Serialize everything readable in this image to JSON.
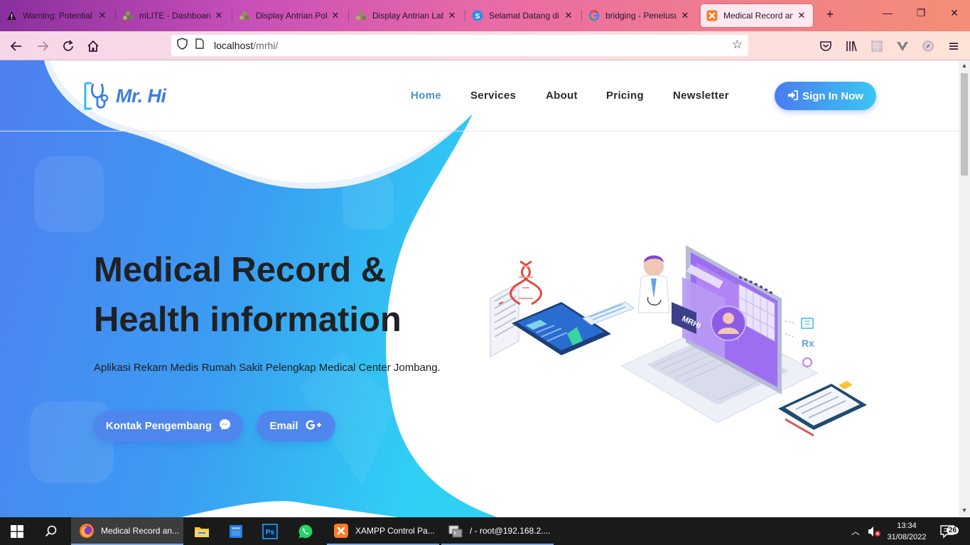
{
  "browser": {
    "tabs": [
      {
        "title": "Warning: Potential S",
        "icon": "warning-icon"
      },
      {
        "title": "mLITE - Dashboard",
        "icon": "mlite-icon"
      },
      {
        "title": "Display Antrian Poli",
        "icon": "mlite-icon"
      },
      {
        "title": "Display Antrian Lab",
        "icon": "mlite-icon"
      },
      {
        "title": "Selamat Datang di S",
        "icon": "skype-icon"
      },
      {
        "title": "bridging - Penelusur",
        "icon": "google-icon"
      },
      {
        "title": "Medical Record and",
        "icon": "xampp-icon",
        "active": true
      }
    ],
    "new_tab": "+",
    "url_host": "localhost",
    "url_path": "/mrhi/"
  },
  "site": {
    "logo_text": "Mr. Hi",
    "nav": [
      "Home",
      "Services",
      "About",
      "Pricing",
      "Newsletter"
    ],
    "active_nav": "Home",
    "signin_label": "Sign In Now",
    "hero": {
      "title_line1": "Medical Record &",
      "title_line2": "Health information",
      "description": "Aplikasi Rekam Medis Rumah Sakit Pelengkap Medical Center Jombang.",
      "cta_contact": "Kontak Pengembang",
      "cta_email": "Email"
    },
    "illustration_label": "MRHI",
    "colors": {
      "accent": "#4f86ee",
      "gradient_start": "#4a7cf0",
      "gradient_end": "#3bc6f3",
      "text_dark": "#202124"
    }
  },
  "taskbar": {
    "items": [
      {
        "label": "Medical Record an...",
        "icon": "firefox-icon"
      },
      {
        "label": "",
        "icon": "file-explorer-icon"
      },
      {
        "label": "",
        "icon": "app-icon"
      },
      {
        "label": "",
        "icon": "photoshop-icon"
      },
      {
        "label": "",
        "icon": "whatsapp-icon"
      },
      {
        "label": "XAMPP Control Pa...",
        "icon": "xampp-icon"
      },
      {
        "label": "/ - root@192.168.2....",
        "icon": "terminal-icon"
      }
    ],
    "time": "13:34",
    "date": "31/08/2022",
    "notifications": "26"
  }
}
